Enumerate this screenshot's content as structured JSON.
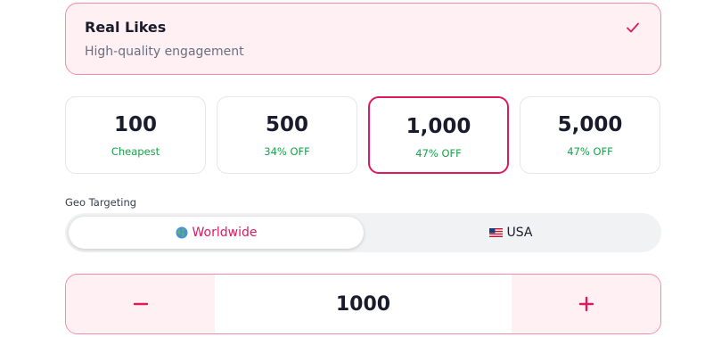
{
  "service": {
    "title": "Real Likes",
    "subtitle": "High-quality engagement",
    "check_icon": "check-icon",
    "selected": true
  },
  "packages": [
    {
      "amount": "100",
      "note": "Cheapest",
      "selected": false
    },
    {
      "amount": "500",
      "note": "34% OFF",
      "selected": false
    },
    {
      "amount": "1,000",
      "note": "47% OFF",
      "selected": true
    },
    {
      "amount": "5,000",
      "note": "47% OFF",
      "selected": false
    }
  ],
  "geo": {
    "label": "Geo Targeting",
    "options": [
      {
        "label": "Worldwide",
        "icon": "globe-icon",
        "active": true
      },
      {
        "label": "USA",
        "icon": "us-flag-icon",
        "active": false
      }
    ]
  },
  "stepper": {
    "value": "1000",
    "minus_icon": "minus-icon",
    "plus_icon": "plus-icon"
  },
  "colors": {
    "accent": "#e0195f",
    "accent_border": "#f48aa8",
    "accent_bg": "#fff0f4",
    "discount_green": "#16a34a",
    "text_dark": "#1a1c2b",
    "text_muted": "#6b6f80"
  }
}
